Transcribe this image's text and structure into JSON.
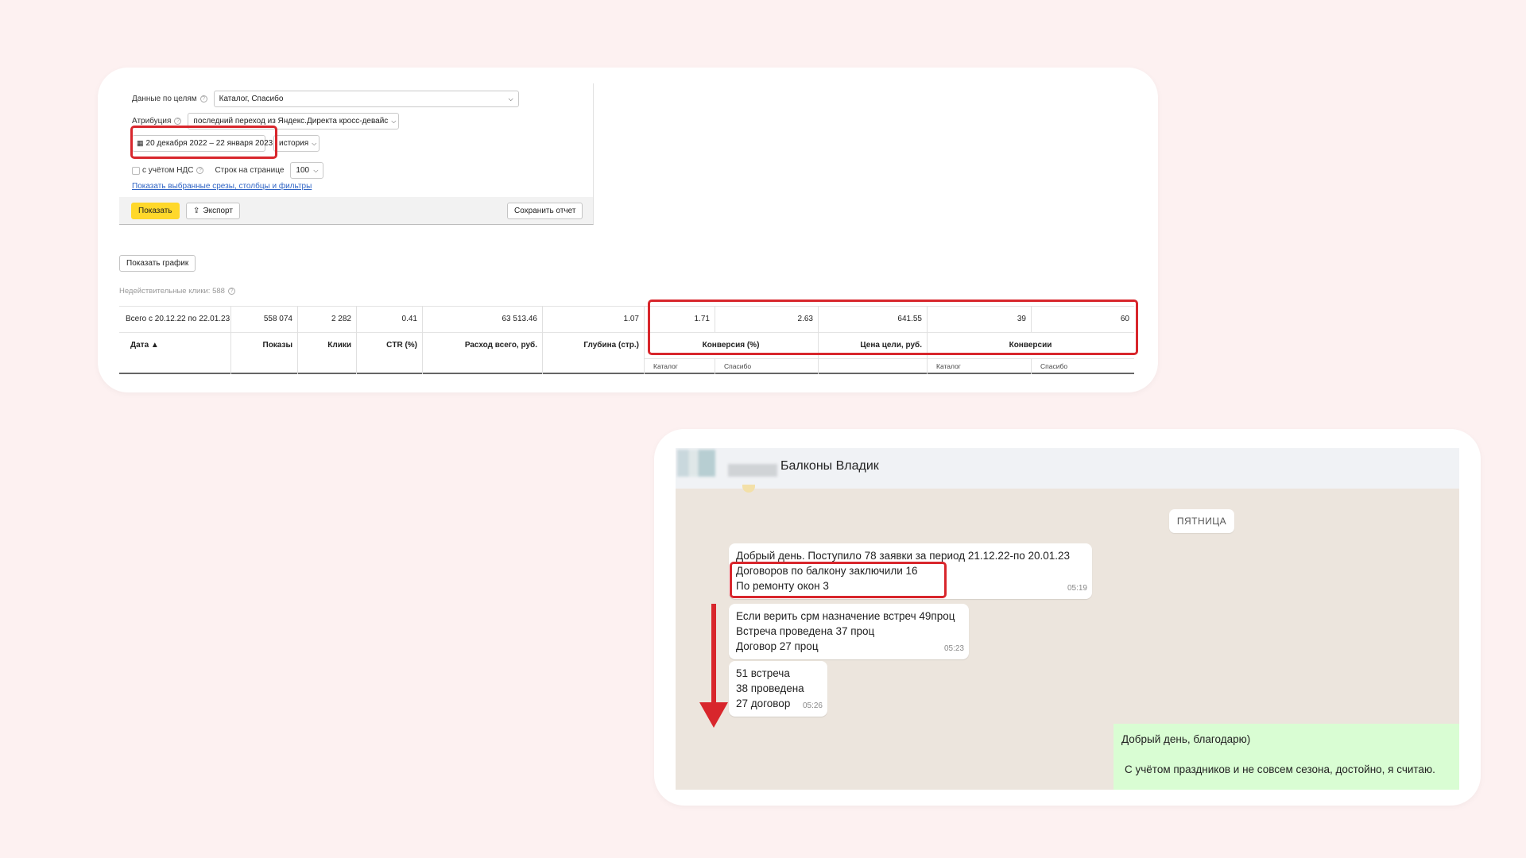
{
  "direct": {
    "filters": {
      "goals_label": "Данные по целям",
      "goals_value": "Каталог, Спасибо",
      "attribution_label": "Атрибуция",
      "attribution_value": "последний переход из Яндекс.Директа кросс-девайс",
      "date_range": "20 декабря 2022 – 22 января 2023",
      "history": "история",
      "vat_label": "с учётом НДС",
      "rows_label": "Строк на странице",
      "rows_value": "100",
      "show_slices_link": "Показать выбранные срезы, столбцы и фильтры"
    },
    "actions": {
      "show": "Показать",
      "export": "Экспорт",
      "save_report": "Сохранить отчет"
    },
    "show_chart": "Показать график",
    "invalid_clicks": "Недействительные клики: 588",
    "table": {
      "total_label": "Всего с 20.12.22 по 22.01.23",
      "totals": {
        "impressions": "558 074",
        "clicks": "2 282",
        "ctr": "0.41",
        "spend": "63 513.46",
        "depth": "1.07",
        "conv_catalog": "1.71",
        "conv_thanks": "2.63",
        "goal_price": "641.55",
        "conversions_catalog": "39",
        "conversions_thanks": "60"
      },
      "headers": {
        "date": "Дата ▲",
        "impressions": "Показы",
        "clicks": "Клики",
        "ctr": "CTR (%)",
        "spend": "Расход всего, руб.",
        "depth": "Глубина (стр.)",
        "conversion_rate": "Конверсия (%)",
        "goal_price": "Цена цели, руб.",
        "conversions": "Конверсии"
      },
      "subheaders": {
        "catalog": "Каталог",
        "thanks": "Спасибо"
      }
    },
    "highlight_color": "#d8262c"
  },
  "chat": {
    "title": "Балконы Владик",
    "date_chip": "ПЯТНИЦА",
    "messages": [
      {
        "lines": [
          "Добрый день. Поступило 78 заявки за период 21.12.22-по 20.01.23",
          "Договоров по балкону заключили 16",
          "По ремонту окон 3"
        ],
        "time": "05:19"
      },
      {
        "lines": [
          "Если верить срм назначение встреч 49проц",
          "Встреча проведена 37 проц",
          "Договор 27 проц"
        ],
        "time": "05:23"
      },
      {
        "lines": [
          "51 встреча",
          "38 проведена",
          "27 договор"
        ],
        "time": "05:26"
      }
    ],
    "reply": {
      "line1": "Добрый день, благодарю)",
      "line2": "С учётом праздников и не совсем сезона, достойно, я считаю."
    }
  }
}
